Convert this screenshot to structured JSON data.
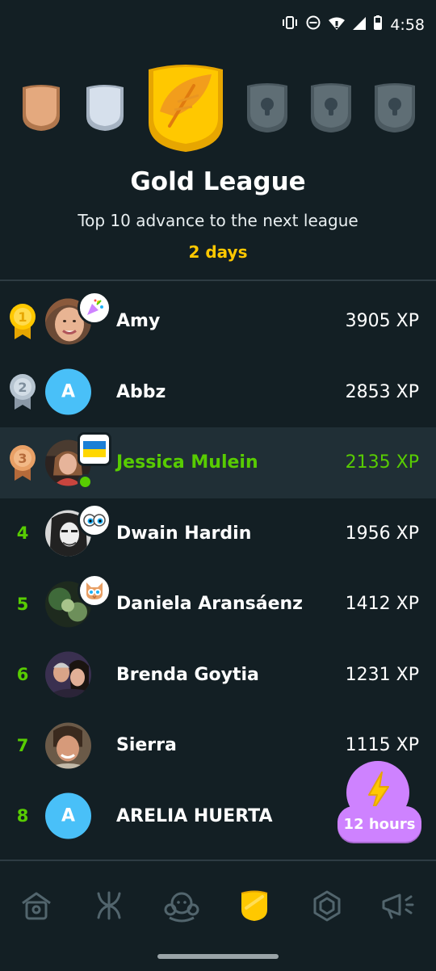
{
  "status": {
    "time": "4:58"
  },
  "league": {
    "title": "Gold League",
    "subtitle": "Top 10 advance to the next league",
    "time_left": "2 days",
    "badges": [
      "bronze-league-badge",
      "silver-league-badge",
      "gold-league-badge",
      "locked-league-badge",
      "locked-league-badge",
      "locked-league-badge"
    ]
  },
  "leaderboard": [
    {
      "rank": "1",
      "name": "Amy",
      "xp": "3905 XP",
      "medal": "gold"
    },
    {
      "rank": "2",
      "name": "Abbz",
      "xp": "2853 XP",
      "medal": "silver",
      "avatar_letter": "A"
    },
    {
      "rank": "3",
      "name": "Jessica Mulein",
      "xp": "2135 XP",
      "medal": "bronze",
      "current_user": true
    },
    {
      "rank": "4",
      "name": "Dwain Hardin",
      "xp": "1956 XP"
    },
    {
      "rank": "5",
      "name": "Daniela Aransáenz",
      "xp": "1412 XP"
    },
    {
      "rank": "6",
      "name": "Brenda Goytia",
      "xp": "1231 XP"
    },
    {
      "rank": "7",
      "name": "Sierra",
      "xp": "1115 XP"
    },
    {
      "rank": "8",
      "name": "ARELIA HUERTA",
      "avatar_letter": "A"
    }
  ],
  "boost": {
    "label": "12 hours"
  },
  "nav": [
    "home-icon",
    "characters-icon",
    "friends-icon",
    "leagues-icon",
    "shop-icon",
    "news-icon"
  ],
  "colors": {
    "background": "#131f24",
    "gold": "#ffc800",
    "green": "#58cc02",
    "purple": "#ce82ff",
    "blue": "#49c0f8"
  }
}
